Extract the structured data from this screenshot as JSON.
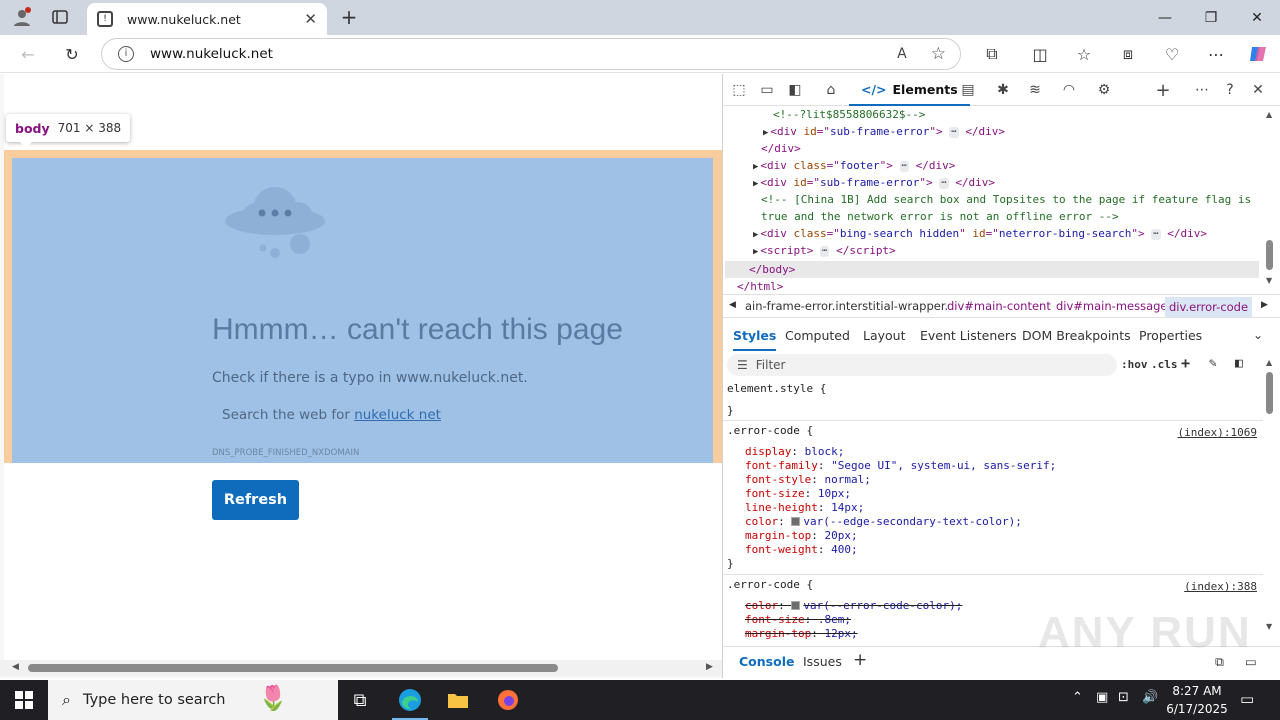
{
  "browser": {
    "tab_title": "www.nukeluck.net",
    "address": "www.nukeluck.net"
  },
  "page": {
    "tooltip_tag": "body",
    "tooltip_dims": "701 × 388",
    "error_title": "Hmmm… can't reach this page",
    "error_check": "Check if there is a typo in www.nukeluck.net.",
    "search_prefix": "Search the web for ",
    "search_link": "nukeluck net",
    "error_code": "DNS_PROBE_FINISHED_NXDOMAIN",
    "refresh_label": "Refresh"
  },
  "devtools": {
    "elements_tab": "Elements",
    "dom": {
      "l1": "<!--?lit$8558806632$-->",
      "l2_id": "sub-frame-error",
      "l4_class": "footer",
      "l5_id": "sub-frame-error",
      "l6_comment_a": "<!-- [China 1B] Add search box and Topsites to the page if feature flag is",
      "l6_comment_b": "true and the network error is not an offline error -->",
      "l7_class": "bing-search hidden",
      "l7_id": "neterror-bing-search"
    },
    "breadcrumbs": [
      "ain-frame-error.interstitial-wrapper.",
      "div#main-content",
      "div#main-message",
      "div.error-code"
    ],
    "style_tabs": [
      "Styles",
      "Computed",
      "Layout",
      "Event Listeners",
      "DOM Breakpoints",
      "Properties"
    ],
    "filter_placeholder": "Filter",
    "hov": ":hov",
    "cls": ".cls",
    "rules": {
      "element_style": "element.style {",
      "rule1_selector": ".error-code {",
      "rule1_source": "(index):1069",
      "rule1_props": [
        {
          "p": "display",
          "v": "block;"
        },
        {
          "p": "font-family",
          "v": "\"Segoe UI\", system-ui, sans-serif;"
        },
        {
          "p": "font-style",
          "v": "normal;"
        },
        {
          "p": "font-size",
          "v": "10px;"
        },
        {
          "p": "line-height",
          "v": "14px;"
        },
        {
          "p": "color",
          "v": "var(--edge-secondary-text-color);"
        },
        {
          "p": "margin-top",
          "v": "20px;"
        },
        {
          "p": "font-weight",
          "v": "400;"
        }
      ],
      "rule2_selector": ".error-code {",
      "rule2_source": "(index):388",
      "rule2_props": [
        {
          "p": "color",
          "v": "var(--error-code-color);"
        },
        {
          "p": "font-size",
          "v": ".8em;"
        },
        {
          "p": "margin-top",
          "v": "12px;"
        }
      ]
    },
    "drawer_tabs": [
      "Console",
      "Issues"
    ]
  },
  "taskbar": {
    "search_placeholder": "Type here to search",
    "time": "8:27 AM",
    "date": "6/17/2025"
  },
  "watermark": "ANY RUN"
}
